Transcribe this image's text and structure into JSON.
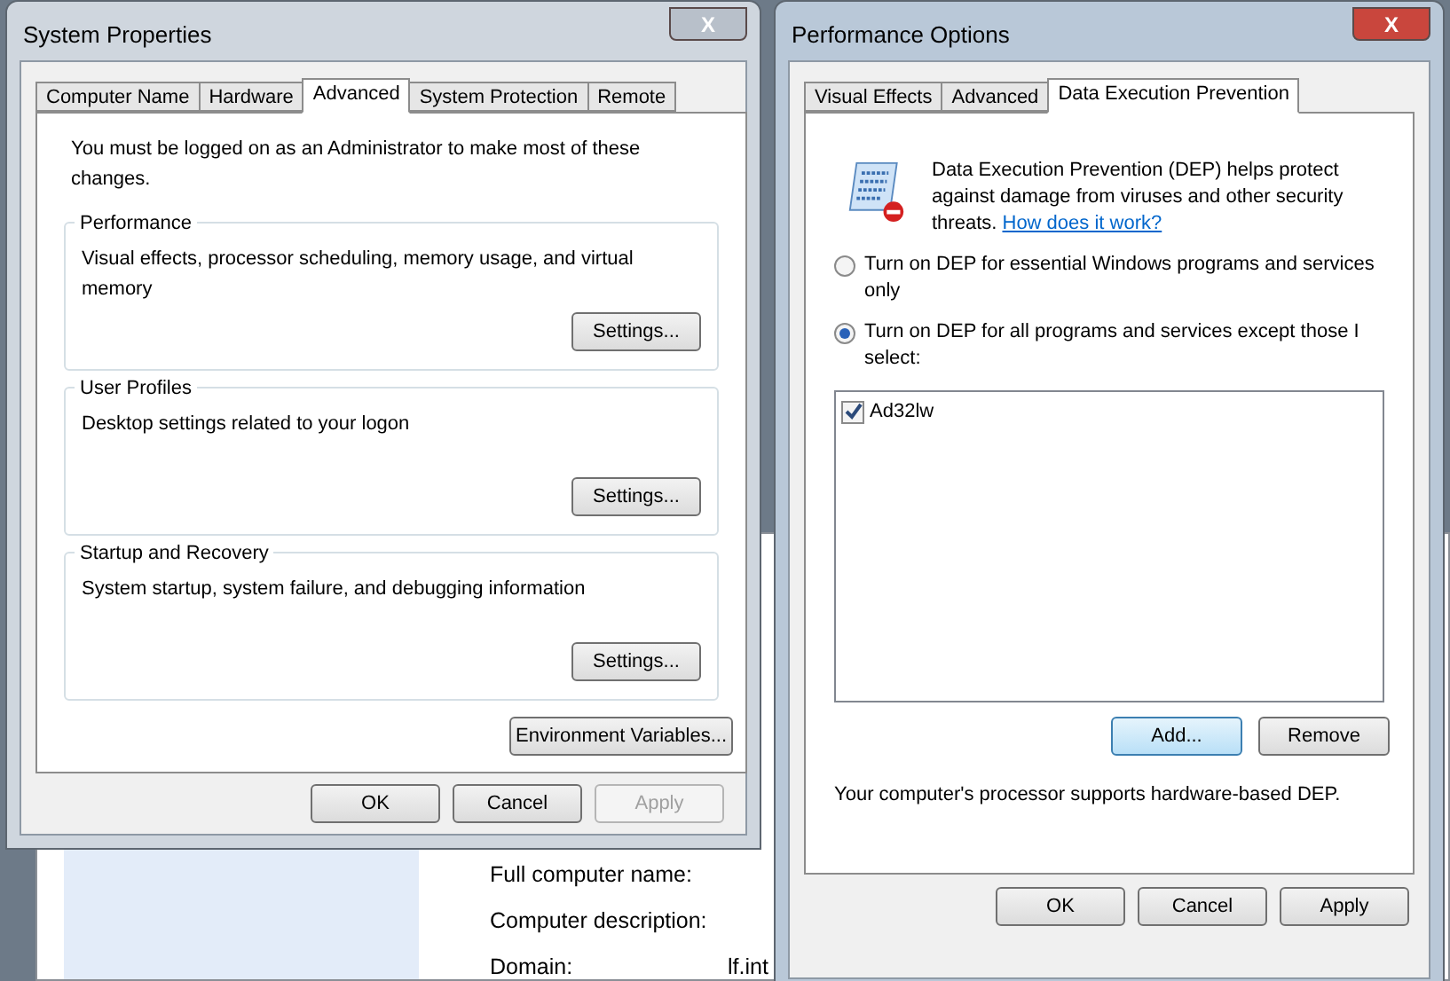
{
  "background_window": {
    "fields": [
      {
        "label": "Full computer name:"
      },
      {
        "label": "Computer description:"
      },
      {
        "label": "Domain:",
        "value": "lf.int"
      }
    ]
  },
  "system_properties": {
    "title": "System Properties",
    "active": false,
    "close_symbol": "X",
    "tabs": [
      {
        "label": "Computer Name",
        "selected": false
      },
      {
        "label": "Hardware",
        "selected": false
      },
      {
        "label": "Advanced",
        "selected": true
      },
      {
        "label": "System Protection",
        "selected": false
      },
      {
        "label": "Remote",
        "selected": false
      }
    ],
    "notice": "You must be logged on as an Administrator to make most of these changes.",
    "groups": [
      {
        "title": "Performance",
        "description": "Visual effects, processor scheduling, memory usage, and virtual memory",
        "button": "Settings..."
      },
      {
        "title": "User Profiles",
        "description": "Desktop settings related to your logon",
        "button": "Settings..."
      },
      {
        "title": "Startup and Recovery",
        "description": "System startup, system failure, and debugging information",
        "button": "Settings..."
      }
    ],
    "environment_button": "Environment Variables...",
    "buttons": [
      {
        "label": "OK",
        "disabled": false
      },
      {
        "label": "Cancel",
        "disabled": false
      },
      {
        "label": "Apply",
        "disabled": true
      }
    ]
  },
  "performance_options": {
    "title": "Performance Options",
    "active": true,
    "close_symbol": "X",
    "tabs": [
      {
        "label": "Visual Effects",
        "selected": false
      },
      {
        "label": "Advanced",
        "selected": false
      },
      {
        "label": "Data Execution Prevention",
        "selected": true
      }
    ],
    "intro": "Data Execution Prevention (DEP) helps protect against damage from viruses and other security threats.",
    "link": "How does it work?",
    "options": [
      {
        "label": "Turn on DEP for essential Windows programs and services only",
        "selected": false
      },
      {
        "label": "Turn on DEP for all programs and services except those I select:",
        "selected": true
      }
    ],
    "programs": [
      {
        "name": "Ad32lw",
        "checked": true
      }
    ],
    "list_buttons": [
      {
        "label": "Add...",
        "focused": true
      },
      {
        "label": "Remove",
        "focused": false
      }
    ],
    "support_note": "Your computer's processor supports hardware-based DEP.",
    "buttons": [
      {
        "label": "OK",
        "disabled": false
      },
      {
        "label": "Cancel",
        "disabled": false
      },
      {
        "label": "Apply",
        "disabled": false
      }
    ]
  }
}
